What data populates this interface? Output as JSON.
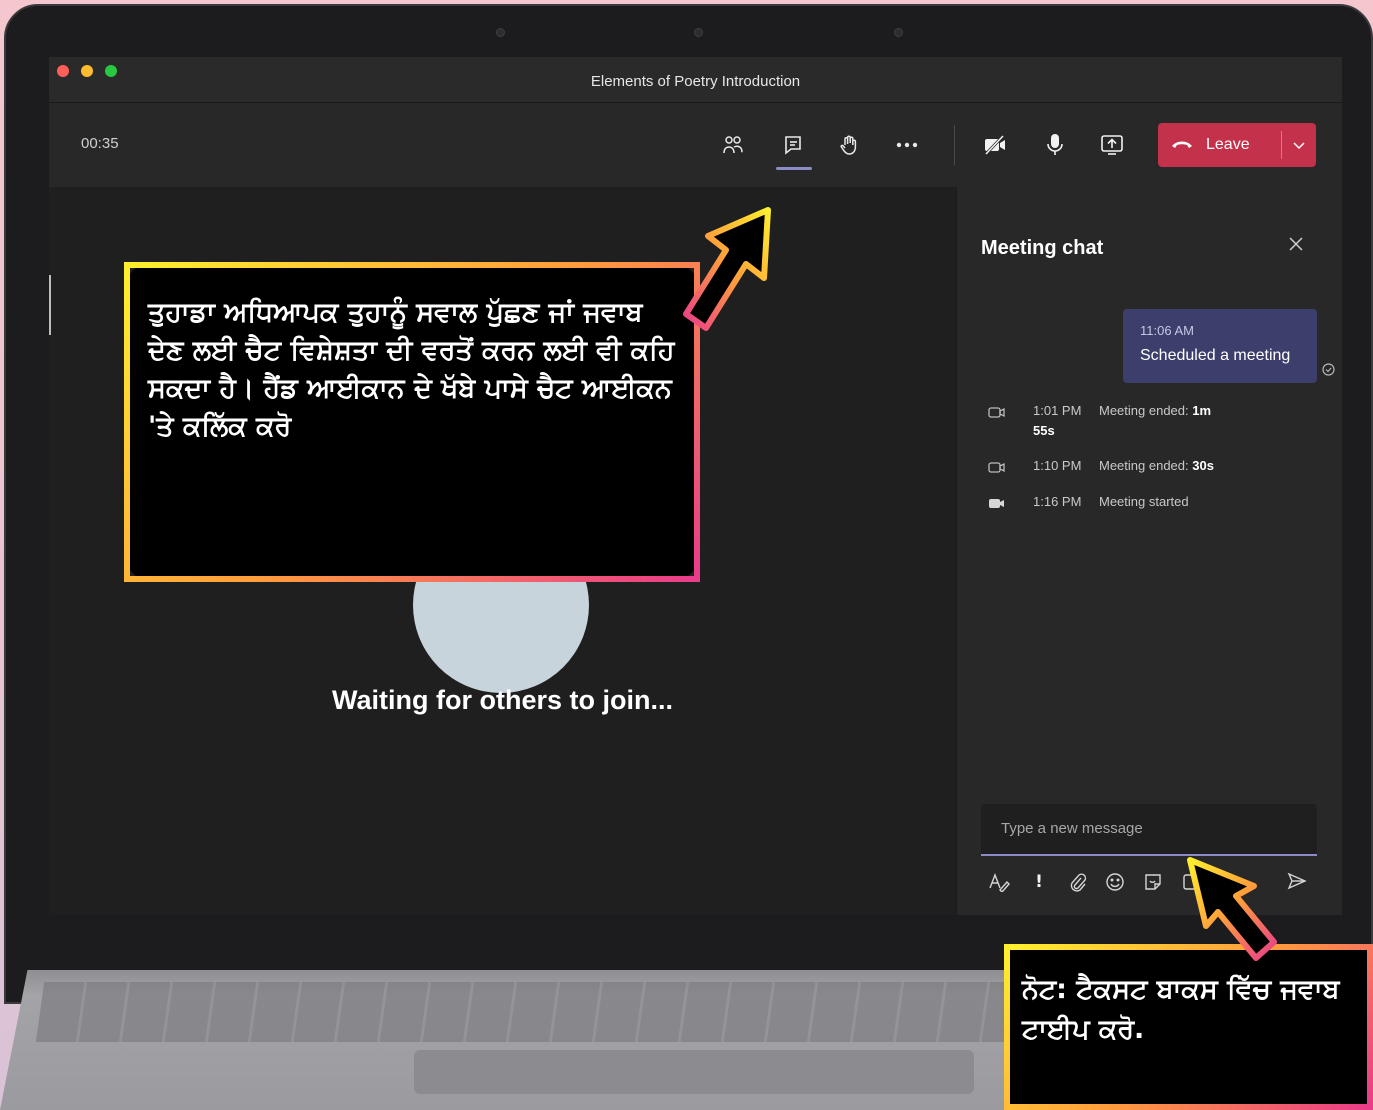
{
  "window": {
    "title": "Elements of Poetry Introduction"
  },
  "meeting_bar": {
    "timer": "00:35",
    "icons": [
      "people-icon",
      "chat-icon",
      "raise-hand-icon",
      "more-icon",
      "camera-off-icon",
      "microphone-icon",
      "share-screen-icon"
    ],
    "leave_label": "Leave"
  },
  "stage": {
    "waiting_text": "Waiting for others to join..."
  },
  "chat": {
    "title": "Meeting chat",
    "bubble": {
      "time": "11:06 AM",
      "text": "Scheduled a meeting"
    },
    "events": [
      {
        "time": "1:01 PM",
        "label": "Meeting ended:",
        "value": "1m",
        "value_cont": "55s"
      },
      {
        "time": "1:10 PM",
        "label": "Meeting ended:",
        "value": "30s"
      },
      {
        "time": "1:16 PM",
        "label": "Meeting started",
        "value": ""
      }
    ],
    "compose_placeholder": "Type a new message"
  },
  "callouts": {
    "chat_tip": "ਤੁਹਾਡਾ ਅਧਿਆਪਕ ਤੁਹਾਨੂੰ ਸਵਾਲ ਪੁੱਛਣ ਜਾਂ ਜਵਾਬ ਦੇਣ ਲਈ ਚੈਟ ਵਿਸ਼ੇਸ਼ਤਾ ਦੀ ਵਰਤੋਂ ਕਰਨ ਲਈ ਵੀ ਕਹਿ ਸਕਦਾ ਹੈ। ਹੈਂਡ ਆਈਕਾਨ ਦੇ ਖੱਬੇ ਪਾਸੇ ਚੈਟ ਆਈਕਨ 'ਤੇ ਕਲਿੱਕ ਕਰੋ",
    "textbox_tip": "ਨੋਟ: ਟੈਕਸਟ ਬਾਕਸ ਵਿੱਚ ਜਵਾਬ ਟਾਈਪ ਕਰੋ."
  },
  "colors": {
    "leave_red": "#c4314b",
    "accent_purple": "#8b8cc7",
    "bubble_bg": "#3c3e6b",
    "callout_yellow": "#ffef2d",
    "callout_pink": "#e93c8a"
  }
}
